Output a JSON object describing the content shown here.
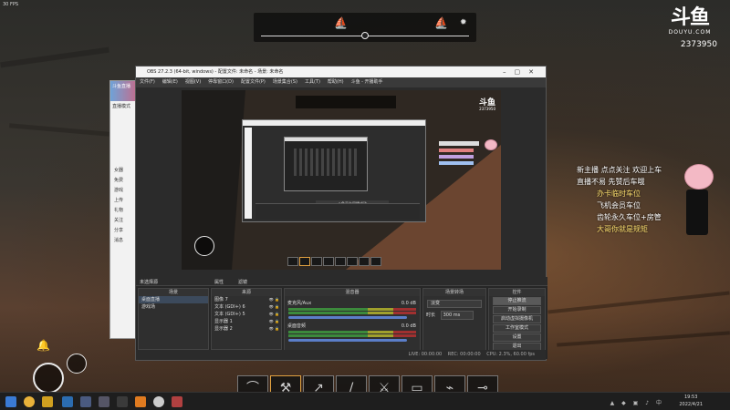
{
  "overlay": {
    "fps_text": "30 FPS",
    "brand_logo": "斗鱼",
    "brand_sub": "DOUYU.COM",
    "room_id": "2373950"
  },
  "obs": {
    "title": "OBS 27.2.3 (64-bit, windows) - 配置文件: 未命名 - 场景: 未命名",
    "menu": [
      "文件(F)",
      "编辑(E)",
      "视图(V)",
      "停靠窗口(D)",
      "配置文件(P)",
      "场景集合(S)",
      "工具(T)",
      "帮助(H)",
      "斗鱼 - 开播助手"
    ],
    "context_bar": {
      "no_source": "未选择源",
      "properties": "属性",
      "filters": "滤镜"
    },
    "docks": {
      "scenes": {
        "title": "场景",
        "items": [
          "桌面直播",
          "游戏场"
        ]
      },
      "sources": {
        "title": "来源",
        "items": [
          "图像 7",
          "文本 (GDI+) 6",
          "文本 (GDI+) 5",
          "显示器 1",
          "显示器 2"
        ]
      },
      "mixer": {
        "title": "混音器",
        "channels": [
          {
            "name": "麦克风/Aux",
            "db": "0.0 dB"
          },
          {
            "name": "桌面音频",
            "db": "0.0 dB"
          }
        ]
      },
      "transitions": {
        "title": "场景转场",
        "type": "淡变",
        "duration_label": "时长",
        "duration_value": "300 ms"
      },
      "controls": {
        "title": "控件",
        "buttons": [
          "停止推流",
          "开始录制",
          "启动虚拟摄像机",
          "工作室模式",
          "设置",
          "退出"
        ]
      }
    },
    "status": {
      "live": "LIVE: 00:00:00",
      "rec": "REC: 00:00:00",
      "cpu": "CPU: 2.3%, 60.00 fps"
    }
  },
  "preview": {
    "inner_label": "斗鱼平台同播成功",
    "inner_brand": "斗鱼",
    "inner_room": "2373950"
  },
  "chat_panel": {
    "header": "斗鱼直播",
    "subtitle": "直播模式",
    "rows": [
      "女器",
      "免费",
      "游戏",
      "上传",
      "礼物",
      "关注",
      "分享",
      "消息"
    ]
  },
  "stickers": {
    "lines": [
      "新主播 点点关注 欢迎上车",
      "直播不易 先赞后车哦",
      "办卡临时车位",
      "飞机会员车位",
      "齿轮永久车位+房管",
      "大哥你就是规矩"
    ]
  },
  "taskbar": {
    "time": "19:53",
    "date": "2022/4/21"
  },
  "icons": {
    "compass": "compass-icon",
    "ship": "ship-icon",
    "star": "star-icon"
  }
}
